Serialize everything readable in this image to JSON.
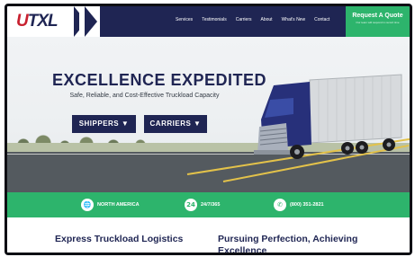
{
  "logo": {
    "text_u": "U",
    "text_rest": "TXL"
  },
  "nav": {
    "links": [
      "Services",
      "Testimonials",
      "Carriers",
      "About",
      "What's New",
      "Contact"
    ]
  },
  "cta": {
    "title": "Request A Quote",
    "subtitle": "Our team will respond in record time"
  },
  "hero": {
    "title": "EXCELLENCE EXPEDITED",
    "subtitle": "Safe, Reliable, and Cost-Effective Truckload Capacity",
    "buttons": {
      "shippers": "SHIPPERS ▼",
      "carriers": "CARRIERS ▼"
    }
  },
  "features": [
    {
      "icon": "globe-icon",
      "glyph": "🌐",
      "label": "NORTH AMERICA"
    },
    {
      "icon": "clock-24-icon",
      "glyph": "24",
      "label": "24/7/365"
    },
    {
      "icon": "phone-icon",
      "glyph": "✆",
      "label": "(800) 351-2821"
    }
  ],
  "content": {
    "left_heading": "Express Truckload Logistics",
    "right_heading": "Pursuing Perfection, Achieving Excellence"
  },
  "colors": {
    "navy": "#1f2553",
    "green": "#2db46c",
    "red": "#c8202f"
  }
}
